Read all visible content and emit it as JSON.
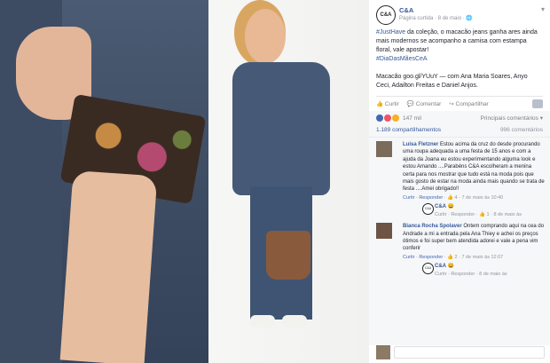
{
  "post": {
    "page_name": "C&A",
    "logo_text": "C&A",
    "meta": "Página curtida · 8 de maio · 🌐",
    "body_tag": "#JustHave",
    "body_text": " da coleção, o macacão jeans ganha ares ainda mais modernos se acompanho a camisa com estampa floral, vale apostar!",
    "hashtag": "#DiaDasMãesCeA",
    "link_text": "Macacão goo.gl/YUuY",
    "with_text": " — com Ana Maria Soares, Anyo Ceci, Adailton Freitas e Daniel Anjos."
  },
  "actions": {
    "like": "Curtir",
    "comment": "Comentar",
    "share": "Compartilhar"
  },
  "reactions": {
    "count": "147 mil",
    "relevant": "Principais comentários ▾"
  },
  "counts": {
    "shares": "1.189 compartilhamentos",
    "comments": "996 comentários"
  },
  "comments": [
    {
      "name": "Luisa Fletzner",
      "text": " Estou acima da cruz do desde procurando uma roupa adequada a uma festa de 15 anos e com a ajuda da Joana eu estou experimentando alguma look e estou Amando ....Parabéns C&A escolheram a menina certa para nos mostrar que tudo está na moda pois que mais gosto de estar na moda ainda mais quando se trata de festa ....Amei obrigado!!",
      "meta_actions": "Curtir · Responder",
      "meta_time": " · 👍 4 · 7 de maio às 10:40",
      "reply": {
        "logo_text": "C&A",
        "name": "C&A",
        "text": " 😀",
        "meta_actions": "Curtir · Responder",
        "meta_time": " · 👍 1 · 8 de maio às"
      }
    },
    {
      "name": "Bianca Rocha Spolaver",
      "text": " Ontem comprando aqui na cea do Andrade a mi a entrada pela Ana Thiey e achei os preços ótimos e foi super bem atendida adorei e vale a pena vim conferir",
      "meta_actions": "Curtir · Responder",
      "meta_time": " · 👍 2 · 7 de maio às 12:07",
      "reply": {
        "logo_text": "C&A",
        "name": "C&A",
        "text": " 😀",
        "meta_actions": "Curtir · Responder",
        "meta_time": " · 8 de maio às"
      }
    }
  ]
}
